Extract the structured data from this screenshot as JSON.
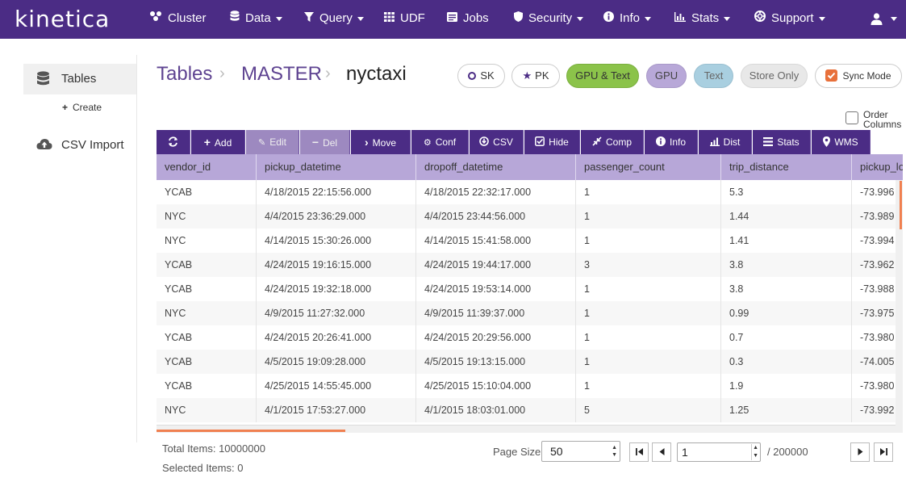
{
  "app": {
    "logo": "kinetica"
  },
  "nav": {
    "items": [
      {
        "label": "Cluster",
        "icon": "cluster-icon",
        "dropdown": false
      },
      {
        "label": "Data",
        "icon": "database-icon",
        "dropdown": true
      },
      {
        "label": "Query",
        "icon": "filter-icon",
        "dropdown": true
      },
      {
        "label": "UDF",
        "icon": "grid-icon",
        "dropdown": false
      },
      {
        "label": "Jobs",
        "icon": "list-icon",
        "dropdown": false
      },
      {
        "label": "Security",
        "icon": "shield-icon",
        "dropdown": true
      },
      {
        "label": "Info",
        "icon": "info-icon",
        "dropdown": true
      },
      {
        "label": "Stats",
        "icon": "bar-chart-icon",
        "dropdown": true
      },
      {
        "label": "Support",
        "icon": "lifebuoy-icon",
        "dropdown": true
      }
    ],
    "user_icon": "user-icon"
  },
  "sidebar": {
    "tables_label": "Tables",
    "create_label": "Create",
    "csv_import_label": "CSV Import"
  },
  "breadcrumb": {
    "root": "Tables",
    "schema": "MASTER",
    "table": "nyctaxi"
  },
  "badges": {
    "sk": "SK",
    "pk": "PK",
    "gpu_text": "GPU & Text",
    "gpu": "GPU",
    "text": "Text",
    "store_only": "Store Only",
    "sync_mode": "Sync Mode",
    "sync_checked": true
  },
  "order_columns": {
    "line1": "Order",
    "line2": "Columns"
  },
  "toolbar": {
    "refresh_icon": "refresh-icon",
    "add": "Add",
    "edit": "Edit",
    "del": "Del",
    "move": "Move",
    "conf": "Conf",
    "csv": "CSV",
    "hide": "Hide",
    "comp": "Comp",
    "info": "Info",
    "dist": "Dist",
    "stats": "Stats",
    "wms": "WMS"
  },
  "table": {
    "columns": [
      "vendor_id",
      "pickup_datetime",
      "dropoff_datetime",
      "passenger_count",
      "trip_distance",
      "pickup_lo"
    ],
    "rows": [
      [
        "YCAB",
        "4/18/2015 22:15:56.000",
        "4/18/2015 22:32:17.000",
        "1",
        "5.3",
        "-73.996"
      ],
      [
        "NYC",
        "4/4/2015 23:36:29.000",
        "4/4/2015 23:44:56.000",
        "1",
        "1.44",
        "-73.989"
      ],
      [
        "NYC",
        "4/14/2015 15:30:26.000",
        "4/14/2015 15:41:58.000",
        "1",
        "1.41",
        "-73.994"
      ],
      [
        "YCAB",
        "4/24/2015 19:16:15.000",
        "4/24/2015 19:44:17.000",
        "3",
        "3.8",
        "-73.962"
      ],
      [
        "YCAB",
        "4/24/2015 19:32:18.000",
        "4/24/2015 19:53:14.000",
        "1",
        "3.8",
        "-73.988"
      ],
      [
        "NYC",
        "4/9/2015 11:27:32.000",
        "4/9/2015 11:39:37.000",
        "1",
        "0.99",
        "-73.975"
      ],
      [
        "YCAB",
        "4/24/2015 20:26:41.000",
        "4/24/2015 20:29:56.000",
        "1",
        "0.7",
        "-73.980"
      ],
      [
        "YCAB",
        "4/5/2015 19:09:28.000",
        "4/5/2015 19:13:15.000",
        "1",
        "0.3",
        "-74.005"
      ],
      [
        "YCAB",
        "4/25/2015 14:55:45.000",
        "4/25/2015 15:10:04.000",
        "1",
        "1.9",
        "-73.980"
      ],
      [
        "NYC",
        "4/1/2015 17:53:27.000",
        "4/1/2015 18:03:01.000",
        "5",
        "1.25",
        "-73.992"
      ]
    ]
  },
  "footer": {
    "total_items": "Total Items: 10000000",
    "selected_items": "Selected Items: 0",
    "page_size_label": "Page Size:",
    "page_size_value": "50",
    "page_value": "1",
    "page_total": "/ 200000"
  },
  "colors": {
    "brand": "#4b2c85",
    "header_row": "#b7a7d8",
    "gpu_text_green": "#8bc34a",
    "gpu_purple": "#b8a8d8",
    "text_blue": "#a9cfe0",
    "scroll_thumb": "#f08050"
  }
}
